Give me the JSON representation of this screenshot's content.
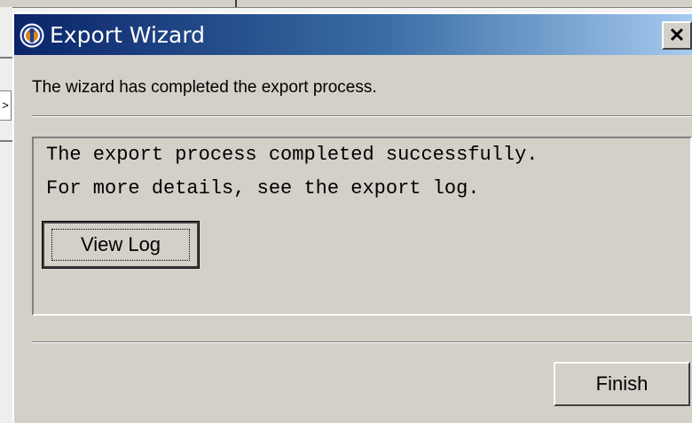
{
  "dialog": {
    "title": "Export Wizard",
    "close_glyph": "✕",
    "icon": "wizard-app-icon",
    "header_message": "The wizard has completed the export process.",
    "content": {
      "line1": "The export process completed successfully.",
      "line2": "For more details, see the export log.",
      "view_log_label": "View Log"
    },
    "finish_label": "Finish"
  },
  "background": {
    "arrow_glyph": ">"
  },
  "colors": {
    "title_gradient_start": "#0a246a",
    "title_gradient_end": "#a6caf0",
    "dialog_face": "#d4d0c8"
  }
}
